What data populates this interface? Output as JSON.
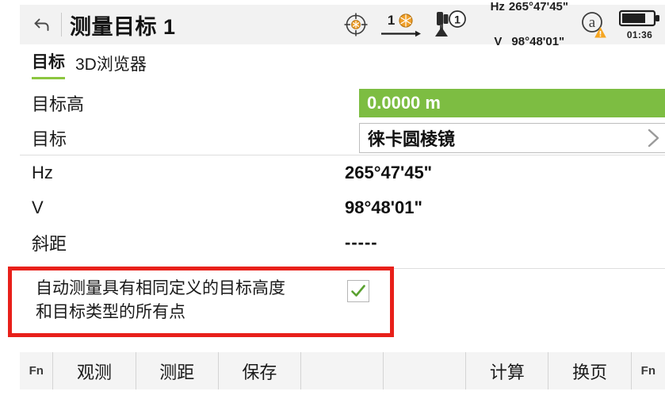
{
  "header": {
    "back_icon": "back-arrow-icon",
    "title": "测量目标 1"
  },
  "status": {
    "target_lock_icon": "crosshair-prism-icon",
    "prism_number": "1",
    "prism_icon": "prism-orange-icon",
    "arrow_icon": "arrow-right-icon",
    "instrument_icon": "total-station-icon",
    "instrument_face": "1",
    "hz_label": "Hz",
    "hz_value": "265°47'45\"",
    "v_label": "V",
    "v_value": "98°48'01\"",
    "atmosphere_icon": "atmosphere-warning-icon",
    "battery_icon": "battery-icon",
    "battery_time": "01:36"
  },
  "tabs": [
    {
      "label": "目标",
      "active": true
    },
    {
      "label": "3D浏览器",
      "active": false
    }
  ],
  "fields": [
    {
      "label": "目标高",
      "value": "0.0000 m",
      "style": "green-field"
    },
    {
      "label": "目标",
      "value": "徕卡圆棱镜",
      "style": "select-field",
      "chevron": "chevron-right-icon"
    },
    {
      "label": "Hz",
      "value": "265°47'45\"",
      "style": "text"
    },
    {
      "label": "V",
      "value": "98°48'01\"",
      "style": "text"
    },
    {
      "label": "斜距",
      "value": "-----",
      "style": "text"
    }
  ],
  "auto_measure": {
    "text_line1": "自动测量具有相同定义的目标高度",
    "text_line2": "和目标类型的所有点",
    "checked": true,
    "check_icon": "checkmark-icon",
    "highlight_color": "#e8201a"
  },
  "toolbar": {
    "fn_left": "Fn",
    "buttons": [
      "观测",
      "测距",
      "保存"
    ],
    "buttons_right": [
      "计算",
      "换页"
    ],
    "fn_right": "Fn"
  },
  "colors": {
    "accent_green": "#7dbd42",
    "tab_underline": "#8cc63f",
    "highlight_red": "#e8201a",
    "bar_gray": "#f2f2f2"
  }
}
